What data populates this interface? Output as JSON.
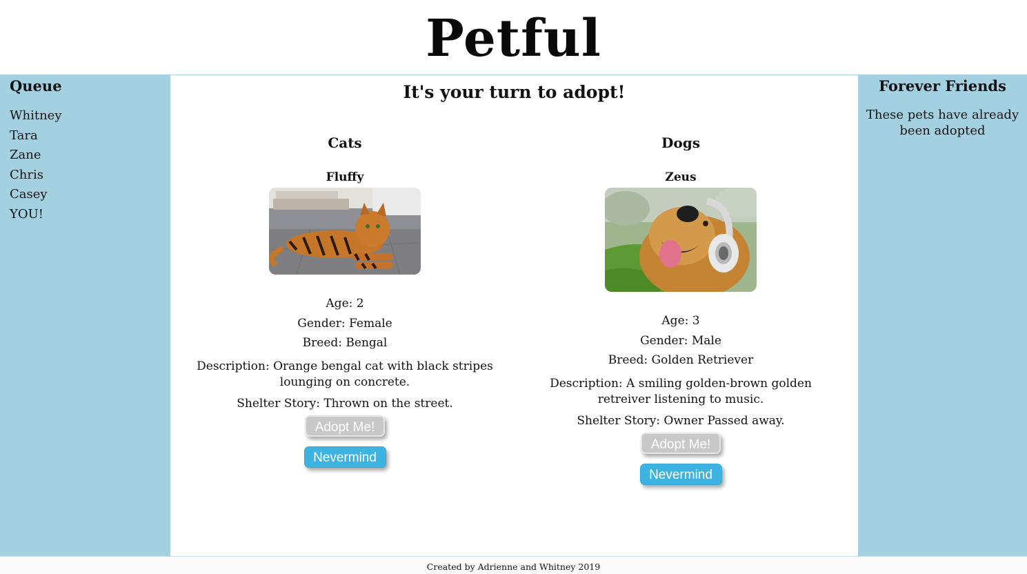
{
  "header": {
    "logo": "Petful"
  },
  "queue": {
    "title": "Queue",
    "people": [
      "Whitney",
      "Tara",
      "Zane",
      "Chris",
      "Casey",
      "YOU!"
    ]
  },
  "main": {
    "title": "It's your turn to adopt!"
  },
  "cats": {
    "heading": "Cats",
    "name": "Fluffy",
    "age": "Age: 2",
    "gender": "Gender: Female",
    "breed": "Breed: Bengal",
    "description": "Description: Orange bengal cat with black stripes lounging on concrete.",
    "story": "Shelter Story: Thrown on the street.",
    "adopt_label": "Adopt Me!",
    "nevermind_label": "Nevermind"
  },
  "dogs": {
    "heading": "Dogs",
    "name": "Zeus",
    "age": "Age: 3",
    "gender": "Gender: Male",
    "breed": "Breed: Golden Retriever",
    "description": "Description: A smiling golden-brown golden retreiver listening to music.",
    "story": "Shelter Story: Owner Passed away.",
    "adopt_label": "Adopt Me!",
    "nevermind_label": "Nevermind"
  },
  "adopted": {
    "title": "Forever Friends",
    "note": "These pets have already been adopted"
  },
  "footer": {
    "text": "Created by Adrienne and Whitney 2019"
  },
  "colors": {
    "panel_bg": "#a4d1e1",
    "adopt_button": "#c8c8c8",
    "nevermind_button": "#3cb3e0"
  }
}
